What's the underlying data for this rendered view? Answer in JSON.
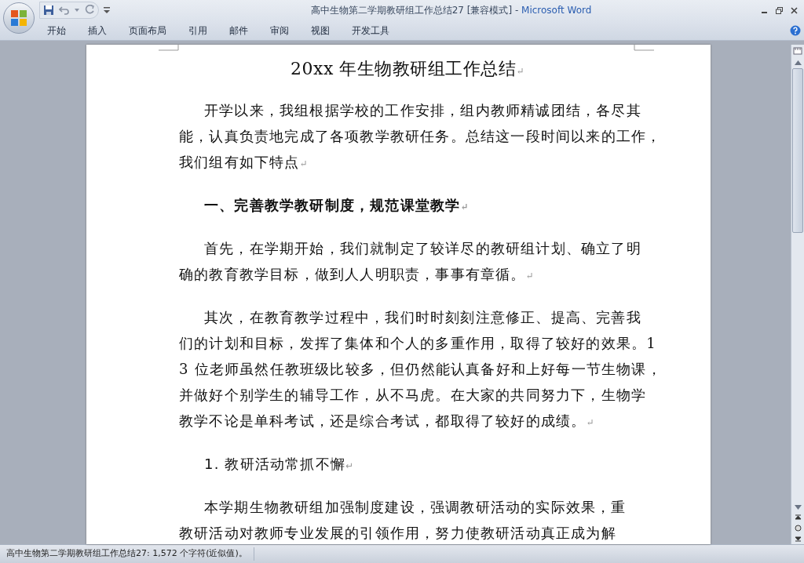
{
  "window": {
    "title": "高中生物第二学期教研组工作总结27 [兼容模式]",
    "separator": " - ",
    "app": "Microsoft Word"
  },
  "ribbon_tabs": [
    {
      "label": "开始",
      "selected": false
    },
    {
      "label": "插入",
      "selected": false
    },
    {
      "label": "页面布局",
      "selected": false
    },
    {
      "label": "引用",
      "selected": false
    },
    {
      "label": "邮件",
      "selected": false
    },
    {
      "label": "审阅",
      "selected": false
    },
    {
      "label": "视图",
      "selected": false
    },
    {
      "label": "开发工具",
      "selected": false
    }
  ],
  "document": {
    "title": "20xx 年生物教研组工作总结",
    "blocks": [
      {
        "kind": "paragraph",
        "lines": [
          "开学以来，我组根据学校的工作安排，组内教师精诚团结，各尽其",
          "能，认真负责地完成了各项教学教研任务。总结这一段时间以来的工作，",
          "我们组有如下特点"
        ]
      },
      {
        "kind": "heading",
        "lines": [
          "一、完善教学教研制度，规范课堂教学"
        ]
      },
      {
        "kind": "paragraph",
        "lines": [
          "首先，在学期开始，我们就制定了较详尽的教研组计划、确立了明",
          "确的教育教学目标，做到人人明职责，事事有章循。"
        ]
      },
      {
        "kind": "paragraph",
        "lines": [
          "其次，在教育教学过程中，我们时时刻刻注意修正、提高、完善我",
          "们的计划和目标，发挥了集体和个人的多重作用，取得了较好的效果。1",
          "3 位老师虽然任教班级比较多，但仍然能认真备好和上好每一节生物课，",
          "并做好个别学生的辅导工作，从不马虎。在大家的共同努力下，生物学",
          "教学不论是单科考试，还是综合考试，都取得了较好的成绩。"
        ]
      },
      {
        "kind": "subheading",
        "lines": [
          "1. 教研活动常抓不懈"
        ]
      },
      {
        "kind": "paragraph",
        "lines": [
          "本学期生物教研组加强制度建设，强调教研活动的实际效果，重",
          "教研活动对教师专业发展的引领作用，努力使教研活动真正成为解"
        ]
      }
    ]
  },
  "paragraph_mark": "↵",
  "status_bar": {
    "text": "高中生物第二学期教研组工作总结27: 1,572 个字符(近似值)。"
  }
}
